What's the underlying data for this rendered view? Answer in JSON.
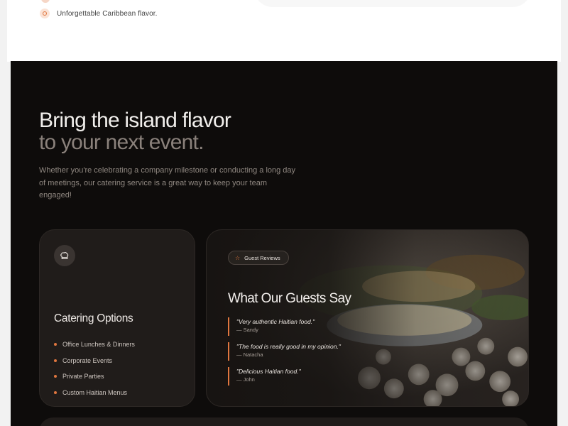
{
  "top": {
    "feature_text": "Unforgettable Caribbean flavor."
  },
  "hero": {
    "headline_line1": "Bring the island flavor",
    "headline_line2": "to your next event.",
    "description": "Whether you're celebrating a company milestone or conducting a long day of meetings, our catering service is a great way to keep your team engaged!"
  },
  "catering": {
    "icon": "chef-hat-icon",
    "title": "Catering Options",
    "options": [
      "Office Lunches & Dinners",
      "Corporate Events",
      "Private Parties",
      "Custom Haitian Menus"
    ]
  },
  "reviews": {
    "badge": "Guest Reviews",
    "badge_icon": "star-icon",
    "title": "What Our Guests Say",
    "items": [
      {
        "quote": "\"Very authentic Haitian food.\"",
        "author": "— Sandy"
      },
      {
        "quote": "\"The food is really good in my opinion.\"",
        "author": "— Natacha"
      },
      {
        "quote": "\"Delicious Haitian food.\"",
        "author": "— John"
      }
    ]
  },
  "colors": {
    "accent": "#e0763f",
    "dark_bg": "#0e0c0b",
    "card_bg": "#201c1a"
  }
}
